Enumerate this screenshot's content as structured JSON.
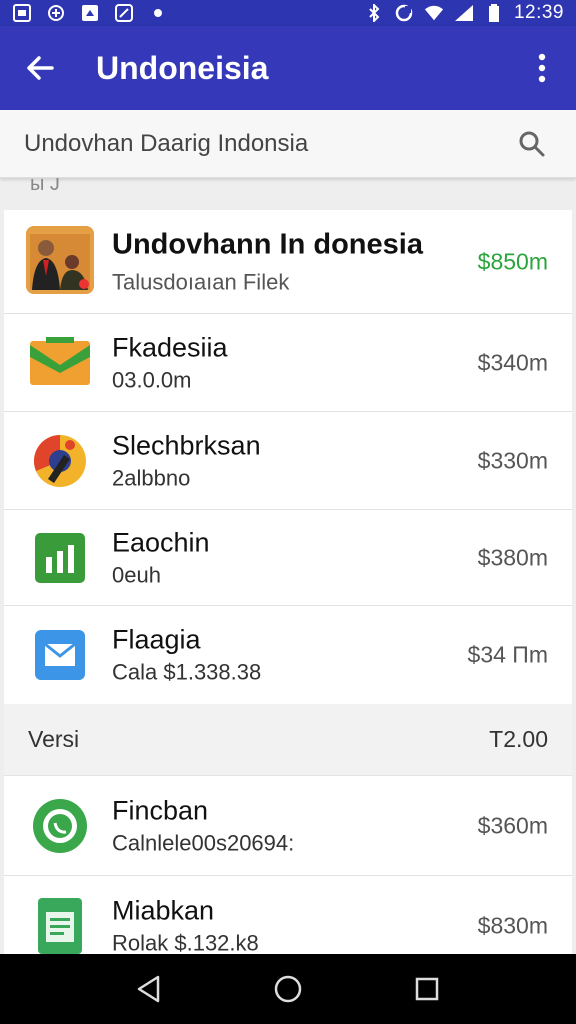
{
  "status_bar": {
    "time": "12:39",
    "icons": [
      "notification-icon",
      "apps-icon",
      "camera-icon",
      "maps-icon",
      "dot-icon",
      "bluetooth-icon",
      "data-saver-icon",
      "wifi-icon",
      "signal-icon",
      "battery-icon"
    ]
  },
  "app_bar": {
    "title": "Undoneisia",
    "back_icon": "arrow-left-icon",
    "menu_icon": "more-vert-icon"
  },
  "search": {
    "text": "Undovhan Daarig  Indonsia",
    "icon": "search-icon"
  },
  "sub_hint": "ы J",
  "items": [
    {
      "title": "Undovhann In donesia",
      "subtitle": "Talusdoıaıan Filek",
      "price": "$850m",
      "icon": "photo-avatar-icon",
      "color": "#e5a046"
    },
    {
      "title": "Fkadesiia",
      "subtitle": "03.0.0m",
      "price": "$340m",
      "icon": "mail-envelope-icon",
      "color": "#f0a030"
    },
    {
      "title": "Slechbrksan",
      "subtitle": "2albbno",
      "price": "$330m",
      "icon": "chrome-icon",
      "color": "#f2a22b"
    },
    {
      "title": "Eaochin",
      "subtitle": "0euh",
      "price": "$380m",
      "icon": "bar-chart-icon",
      "color": "#3a9b3a"
    },
    {
      "title": "Flaagia",
      "subtitle": "Cala $1.338.38",
      "price": "$34 Пm",
      "icon": "inbox-mail-icon",
      "color": "#3d95e8"
    }
  ],
  "section": {
    "label": "Versi",
    "value": "T2.00"
  },
  "items2": [
    {
      "title": "Fincban",
      "subtitle": "Calnlele00s20694:",
      "price": "$360m",
      "icon": "whatsapp-icon",
      "color": "#3aa84a"
    },
    {
      "title": "Miabkan",
      "subtitle": "Rolak $.132.k8",
      "price": "$830m",
      "icon": "docs-icon",
      "color": "#3aa85a"
    }
  ],
  "nav": {
    "back": "nav-back-icon",
    "home": "nav-home-icon",
    "recents": "nav-recents-icon"
  },
  "colors": {
    "primary": "#3538b8",
    "status": "#2d35b0",
    "price_green": "#2aa53c"
  }
}
